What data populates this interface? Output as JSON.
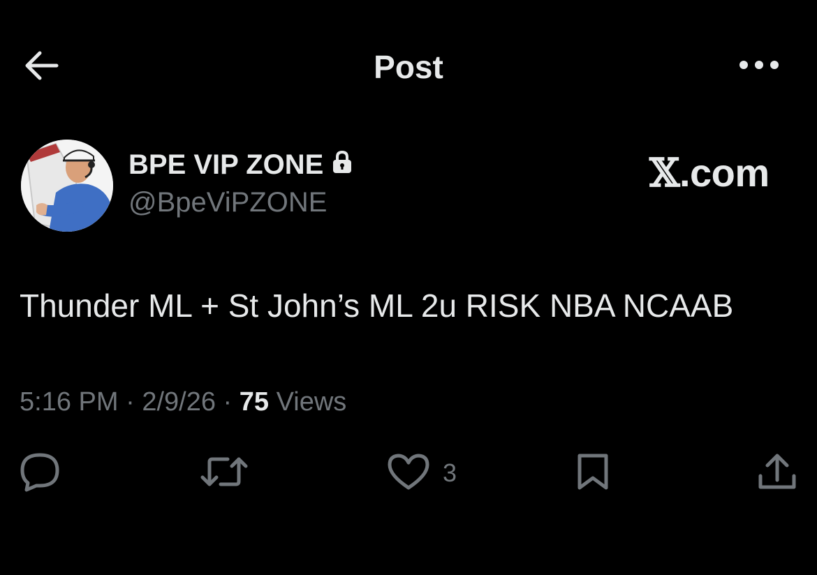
{
  "header": {
    "title": "Post",
    "back_icon": "arrow-left-icon",
    "more_icon": "more-horizontal-icon"
  },
  "author": {
    "display_name": "BPE VIP ZONE",
    "handle": "@BpeViPZONE",
    "protected_icon": "lock-icon",
    "avatar": "avatar-image"
  },
  "watermark": {
    "logo": "𝕏",
    "suffix": ".com"
  },
  "post": {
    "text": "Thunder ML + St John’s ML 2u RISK NBA NCAAB"
  },
  "meta": {
    "time": "5:16 PM",
    "sep1": " · ",
    "date": "2/9/26",
    "sep2": " · ",
    "views_count": "75",
    "views_label": " Views"
  },
  "actions": {
    "reply_icon": "reply-icon",
    "repost_icon": "repost-icon",
    "like_icon": "heart-icon",
    "like_count": "3",
    "bookmark_icon": "bookmark-icon",
    "share_icon": "share-icon"
  },
  "colors": {
    "background": "#000000",
    "primary_text": "#e7e9ea",
    "secondary_text": "#71767b"
  }
}
